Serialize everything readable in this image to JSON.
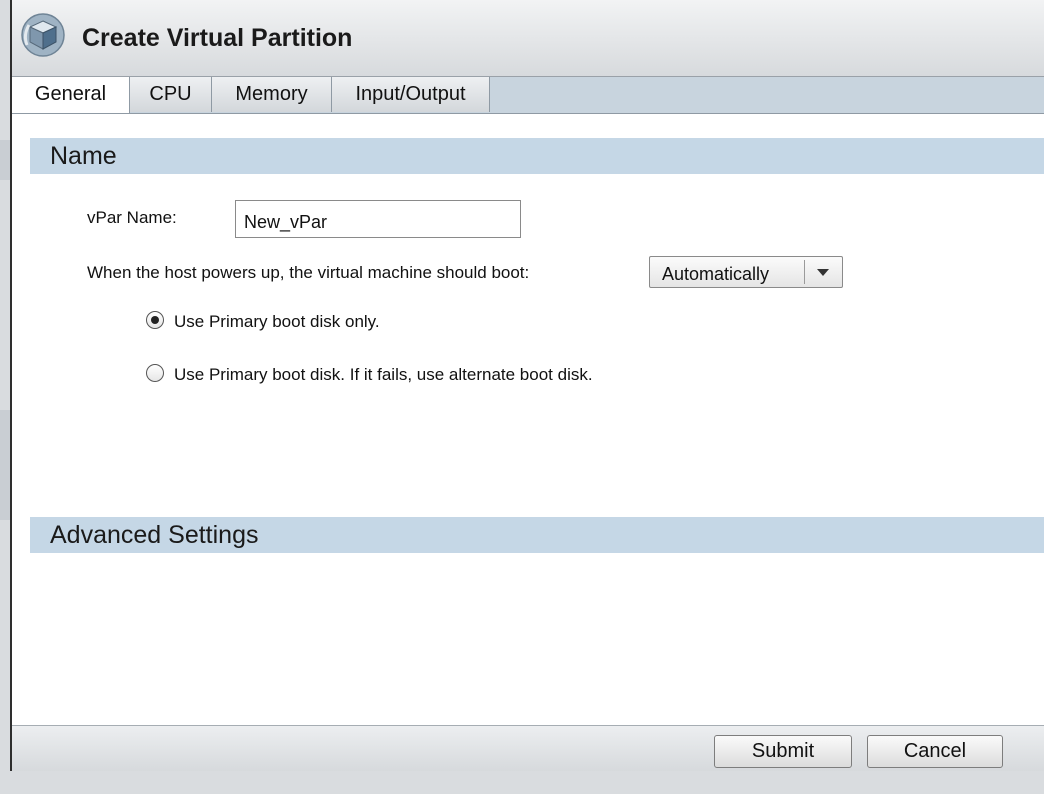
{
  "window": {
    "title": "Create Virtual Partition",
    "icon": "virtual-partition-cube-icon"
  },
  "tabs": [
    {
      "label": "General",
      "active": true
    },
    {
      "label": "CPU",
      "active": false
    },
    {
      "label": "Memory",
      "active": false
    },
    {
      "label": "Input/Output",
      "active": false
    }
  ],
  "name_section": {
    "header": "Name",
    "vpar_name_label": "vPar Name:",
    "vpar_name_value": "New_vPar",
    "boot_label": "When the host powers up, the virtual machine should boot:",
    "boot_select_value": "Automatically",
    "radio_options": [
      {
        "label": "Use Primary boot disk only.",
        "checked": true
      },
      {
        "label": "Use Primary boot disk. If it fails, use alternate boot disk.",
        "checked": false
      }
    ]
  },
  "advanced_section": {
    "header": "Advanced Settings"
  },
  "footer": {
    "submit_label": "Submit",
    "cancel_label": "Cancel"
  },
  "colors": {
    "section_header_bg": "#c5d7e6",
    "tabbar_bg": "#c8d4de",
    "dialog_bg": "#ffffff"
  }
}
